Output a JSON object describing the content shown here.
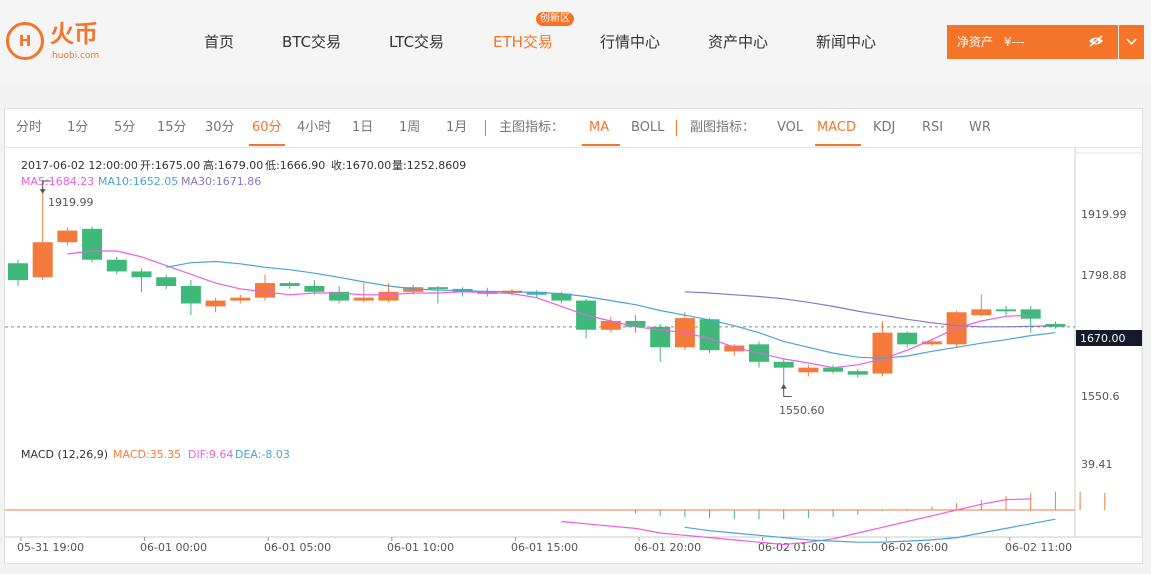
{
  "brand": {
    "name_cn": "火币",
    "name_en": "huobi.com",
    "mark": "H"
  },
  "nav": {
    "items": [
      "首页",
      "BTC交易",
      "LTC交易",
      "ETH交易",
      "行情中心",
      "资产中心",
      "新闻中心"
    ],
    "active_index": 3,
    "badge": "创新区"
  },
  "asset": {
    "label": "净资产",
    "value": "¥---"
  },
  "toolbar": {
    "periods": [
      "分时",
      "1分",
      "5分",
      "15分",
      "30分",
      "60分",
      "4小时",
      "1日",
      "1周",
      "1月"
    ],
    "active_period": "60分",
    "main_label": "主图指标：",
    "main_indicators": [
      "MA",
      "BOLL"
    ],
    "active_main": "MA",
    "sub_label": "副图指标：",
    "sub_indicators": [
      "VOL",
      "MACD",
      "KDJ",
      "RSI",
      "WR"
    ],
    "active_sub": "MACD"
  },
  "info": {
    "date": "2017-06-02 12:00:00",
    "open": "开:1675.00",
    "high": "高:1679.00",
    "low": "低:1666.90",
    "close": "收:1670.00",
    "volume": "量:1252.8609",
    "ma5": "MA5:1684.23",
    "ma10": "MA10:1652.05",
    "ma30": "MA30:1671.86"
  },
  "macd_info": {
    "name": "MACD  (12,26,9)",
    "macd": "MACD:35.35",
    "dif": "DIF:9.64",
    "dea": "DEA:-8.03"
  },
  "colors": {
    "up": "#f47a3c",
    "down": "#3fb97a",
    "ma5": "#e95fe3",
    "ma10": "#4aa3d8",
    "ma30": "#8b77c8",
    "accent": "#f4752a"
  },
  "chart_data": {
    "type": "candlestick",
    "y_ticks": [
      1919.99,
      1798.88,
      1670.0,
      1550.6
    ],
    "ylim": [
      1488,
      1968
    ],
    "current_price": "1670.00",
    "high_marker": "1919.99",
    "low_marker": "1550.60",
    "x_labels": [
      "05-31 19:00",
      "06-01 00:00",
      "06-01 05:00",
      "06-01 10:00",
      "06-01 15:00",
      "06-01 20:00",
      "06-02 01:00",
      "06-02 06:00",
      "06-02 11:00"
    ],
    "candles": [
      [
        1779,
        1750,
        1785,
        1740
      ],
      [
        1755,
        1815,
        1919.99,
        1750
      ],
      [
        1815,
        1835,
        1840,
        1810
      ],
      [
        1838,
        1785,
        1842,
        1780
      ],
      [
        1785,
        1765,
        1790,
        1760
      ],
      [
        1765,
        1755,
        1770,
        1730
      ],
      [
        1755,
        1740,
        1760,
        1735
      ],
      [
        1740,
        1710,
        1750,
        1690
      ],
      [
        1705,
        1715,
        1720,
        1695
      ],
      [
        1715,
        1720,
        1725,
        1710
      ],
      [
        1720,
        1745,
        1760,
        1715
      ],
      [
        1745,
        1740,
        1748,
        1735
      ],
      [
        1740,
        1730,
        1750,
        1725
      ],
      [
        1730,
        1715,
        1740,
        1710
      ],
      [
        1715,
        1720,
        1745,
        1712
      ],
      [
        1715,
        1730,
        1745,
        1712
      ],
      [
        1730,
        1738,
        1742,
        1725
      ],
      [
        1738,
        1735,
        1740,
        1710
      ],
      [
        1735,
        1730,
        1738,
        1722
      ],
      [
        1730,
        1727,
        1737,
        1722
      ],
      [
        1728,
        1732,
        1735,
        1724
      ],
      [
        1730,
        1725,
        1733,
        1720
      ],
      [
        1727,
        1715,
        1730,
        1710
      ],
      [
        1715,
        1665,
        1718,
        1650
      ],
      [
        1665,
        1680,
        1688,
        1660
      ],
      [
        1680,
        1670,
        1690,
        1660
      ],
      [
        1670,
        1635,
        1675,
        1610
      ],
      [
        1635,
        1685,
        1695,
        1630
      ],
      [
        1683,
        1630,
        1686,
        1625
      ],
      [
        1628,
        1638,
        1640,
        1620
      ],
      [
        1640,
        1610,
        1645,
        1600
      ],
      [
        1610,
        1600,
        1615,
        1570
      ],
      [
        1592,
        1600,
        1605,
        1585
      ],
      [
        1600,
        1593,
        1605,
        1590
      ],
      [
        1594,
        1588,
        1598,
        1583
      ],
      [
        1590,
        1660,
        1680,
        1585
      ],
      [
        1660,
        1640,
        1662,
        1635
      ],
      [
        1640,
        1645,
        1650,
        1638
      ],
      [
        1640,
        1695,
        1698,
        1635
      ],
      [
        1690,
        1700,
        1725,
        1688
      ],
      [
        1700,
        1698,
        1706,
        1690
      ],
      [
        1700,
        1684,
        1706,
        1660
      ],
      [
        1675,
        1670,
        1679,
        1666.9
      ]
    ],
    "ma5": [
      null,
      null,
      1795,
      1800,
      1800,
      1790,
      1775,
      1760,
      1745,
      1735,
      1730,
      1725,
      1728,
      1728,
      1725,
      1725,
      1728,
      1728,
      1730,
      1729,
      1727,
      1720,
      1705,
      1690,
      1680,
      1670,
      1665,
      1660,
      1650,
      1635,
      1625,
      1615,
      1608,
      1600,
      1605,
      1615,
      1630,
      1648,
      1668,
      1680,
      1688,
      1690
    ],
    "ma10": [
      null,
      null,
      null,
      1772,
      1780,
      1782,
      1778,
      1772,
      1768,
      1762,
      1755,
      1747,
      1740,
      1735,
      1733,
      1732,
      1731,
      1730,
      1729,
      1727,
      1722,
      1715,
      1708,
      1698,
      1690,
      1682,
      1672,
      1660,
      1645,
      1635,
      1625,
      1618,
      1616,
      1620,
      1628,
      1635,
      1642,
      1648,
      1655,
      1660
    ],
    "ma30": [
      1730,
      1728,
      1725,
      1722,
      1718,
      1712,
      1705,
      1697,
      1690,
      1683,
      1677,
      1672,
      1670,
      1670,
      1671,
      1672
    ],
    "macd_hist_ylim": [
      -20,
      40
    ],
    "macd_hist": [
      0,
      0,
      0,
      0,
      0,
      0,
      0,
      0,
      0,
      0,
      0,
      0,
      0,
      0,
      0,
      0,
      0,
      0,
      0,
      0,
      0,
      0,
      0,
      0,
      0,
      -3,
      -5,
      -6,
      -7,
      -8,
      -8,
      -8,
      -7,
      -6,
      -4,
      -1,
      1,
      3,
      6,
      9,
      12,
      15,
      16,
      16,
      15
    ],
    "dif": [
      null,
      null,
      null,
      null,
      null,
      null,
      null,
      null,
      null,
      null,
      null,
      null,
      null,
      null,
      null,
      null,
      null,
      null,
      null,
      null,
      -10,
      -12,
      -14,
      -16,
      -20,
      -22,
      -24,
      -26,
      -28,
      -30,
      -28,
      -25,
      -20,
      -15,
      -10,
      -5,
      0,
      5,
      9,
      9.64
    ],
    "dea": [
      null,
      null,
      null,
      null,
      null,
      null,
      null,
      null,
      null,
      null,
      null,
      null,
      null,
      null,
      null,
      null,
      null,
      null,
      null,
      null,
      null,
      null,
      null,
      null,
      null,
      -15,
      -18,
      -20,
      -22,
      -24,
      -26,
      -27,
      -28,
      -28,
      -27,
      -26,
      -24,
      -20,
      -16,
      -12,
      -8.03
    ],
    "macd_top": "39.41"
  }
}
